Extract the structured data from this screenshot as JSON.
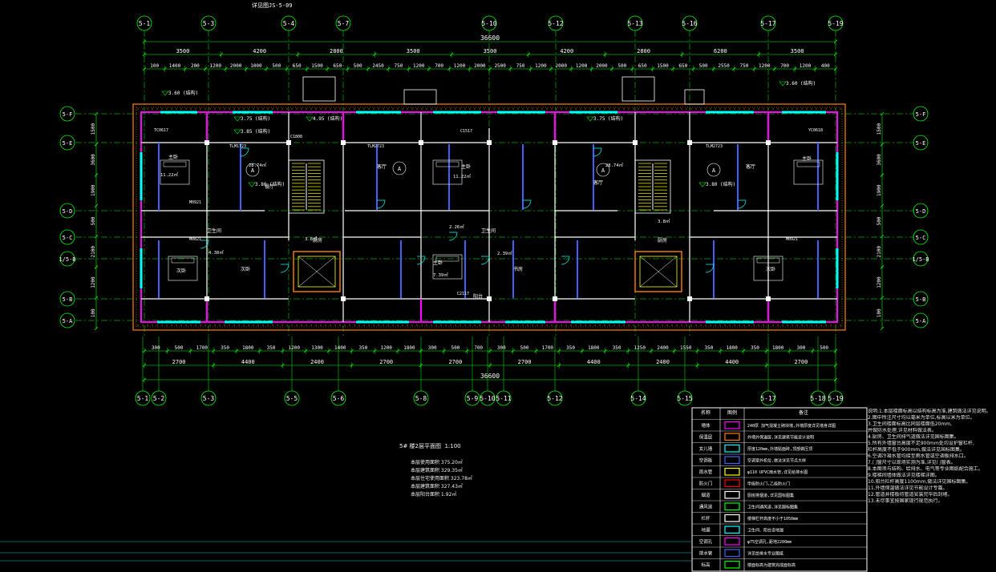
{
  "drawing": {
    "total_dim_top": "36600",
    "total_dim_bottom": "36600",
    "scale_title": "5# 楼2层平面图",
    "scale": "1:100",
    "ref_label": "详见图JS-5-09",
    "area_lines": [
      "本层使用面积 375.20㎡",
      "本层建筑面积 329.35㎡",
      "本层住宅使用面积 323.78㎡",
      "本层建筑面积 327.43㎡",
      "本层阳台面积 1.92㎡"
    ]
  },
  "axes_top": [
    "5-1",
    "5-3",
    "5-4",
    "5-7",
    "5-10",
    "5-12",
    "5-13",
    "5-16",
    "5-17",
    "5-19"
  ],
  "axes_bottom": [
    "5-1",
    "5-2",
    "5-3",
    "5-5",
    "5-6",
    "5-8",
    "5-9",
    "5-10",
    "5-11",
    "5-12",
    "5-14",
    "5-15",
    "5-17",
    "5-18",
    "5-19"
  ],
  "axes_left": [
    "5-F",
    "5-E",
    "5-D",
    "5-C",
    "1/5-B",
    "5-B",
    "5-A"
  ],
  "axes_right": [
    "5-F",
    "5-E",
    "5-D",
    "5-C",
    "1/5-B",
    "5-B",
    "5-A"
  ],
  "dims_top_row1": [
    "3500",
    "4200",
    "2800",
    "3500",
    "3500",
    "4200",
    "2800",
    "6200",
    "3500"
  ],
  "dims_top_row2": [
    "100",
    "1400",
    "200",
    "1200",
    "2000",
    "1000",
    "500",
    "650",
    "1500",
    "650",
    "500",
    "2450",
    "750",
    "1200",
    "700",
    "1200",
    "2000",
    "2500",
    "750",
    "1200",
    "2000",
    "1200",
    "2000",
    "500",
    "650",
    "1500",
    "650",
    "500",
    "2550",
    "750",
    "1200",
    "700",
    "1200",
    "400"
  ],
  "dims_bottom_row1": [
    "300",
    "500",
    "1700",
    "350",
    "1800",
    "350",
    "1200",
    "1300",
    "1400",
    "350",
    "1200",
    "1800",
    "300",
    "500",
    "700",
    "300",
    "500",
    "1700",
    "350",
    "1800",
    "350",
    "1250",
    "2400",
    "1550",
    "350",
    "1800",
    "350",
    "1800",
    "300",
    "500"
  ],
  "dims_bottom_row2": [
    "2700",
    "4400",
    "2400",
    "2700",
    "2700",
    "2700",
    "4400",
    "2400",
    "4400",
    "2700"
  ],
  "dims_left": [
    "1500",
    "3600",
    "1900",
    "500",
    "2100",
    "1200",
    "100"
  ],
  "dims_right": [
    "1500",
    "3600",
    "1900",
    "500",
    "2100",
    "1200",
    "100"
  ],
  "room_labels": [
    "主卧",
    "主卧",
    "次卧",
    "次卧",
    "客厅",
    "客厅",
    "卫生间",
    "卫生间",
    "厨房",
    "厨房",
    "餐厅",
    "阳台",
    "书房",
    "主卧",
    "主卧",
    "客厅",
    "次卧"
  ],
  "room_areas": [
    "11.22㎡",
    "11.22㎡",
    "28.74㎡",
    "28.74㎡",
    "4.38㎡",
    "2.26㎡",
    "7.39㎡",
    "2.39㎡",
    "3.8㎡",
    "3.8㎡"
  ],
  "elevations": [
    "3.75 (结构)",
    "3.60 (结构)",
    "3.80 (结构)",
    "3.85 (结构)",
    "4.95 (结构)",
    "3.75 (结构)",
    "3.60 (结构)",
    "3.80 (结构)"
  ],
  "door_tags": [
    "M0921",
    "M0821",
    "TLM1723",
    "C1808",
    "TLM2723",
    "C1517",
    "TLM2723",
    "M0921",
    "C2117",
    "TC0617",
    "YC0618"
  ],
  "legend": {
    "header": [
      "名称",
      "图例",
      "备注"
    ],
    "rows": [
      {
        "name": "墙体",
        "note": "240厚 加气混凝土砌块墙,外墙厚度详见墙身详图"
      },
      {
        "name": "保温层",
        "note": "外墙外保温层,详见建筑节能设计说明"
      },
      {
        "name": "女儿墙",
        "note": "厚度120mm,外墙贴面砖,顶部做压顶"
      },
      {
        "name": "空调板",
        "note": "空调室外机位,做法详见节点大样"
      },
      {
        "name": "雨水管",
        "note": "φ110 UPVC雨水管,详见给排水图"
      },
      {
        "name": "防火门",
        "note": "甲级防火门,乙级防火门"
      },
      {
        "name": "烟道",
        "note": "厨房排烟道,详见国标图集"
      },
      {
        "name": "通风道",
        "note": "卫生间通风道,详见国标图集"
      },
      {
        "name": "栏杆",
        "note": "楼梯栏杆高度不小于1050mm"
      },
      {
        "name": "地漏",
        "note": "卫生间、阳台设地漏"
      },
      {
        "name": "空调孔",
        "note": "φ75空调孔,距地2200mm"
      },
      {
        "name": "排水管",
        "note": "详见给排水专业图纸"
      },
      {
        "name": "标高",
        "note": "楼面标高为建筑完成面标高"
      }
    ]
  },
  "notes": [
    "说明:1.本层楼面标高以结构标高为准,建筑做法详见说明。",
    "2.图中所注尺寸均以毫米为单位,标高以米为单位。",
    "3.卫生间楼面标高比同层楼面低20mm,",
    "并做防水处理,详见材料做法表。",
    "4.厨房、卫生间排气道做法详见国标图集。",
    "5.所有外墙窗台高度不足900mm处均设护窗栏杆,",
    "栏杆高度不低于900mm,做法详见国标图集。",
    "6.空调冷凝水管均接至雨水管或空调板排水口。",
    "7.门窗尺寸以现场实测为准,详见门窗表。",
    "8.本图须与结构、给排水、电气等专业图纸配合施工。",
    "9.楼梯间墙体做法详见楼梯详图。",
    "10.阳台栏杆高度1100mm,做法详见国标图集。",
    "11.外墙保温做法详见节能设计专篇。",
    "12.管道井楼板待管道安装完毕后封堵。",
    "13.未尽事宜按国家现行规范执行。"
  ],
  "colors": {
    "background": "#000000",
    "axis": "#00ff00",
    "dimension": "#00ff00",
    "wall": "#ff00ff",
    "wall_inner": "#ffffff",
    "insulation": "#ff8000",
    "window": "#00ffff",
    "door": "#4060ff",
    "text": "#ffffff",
    "elev_text": "#ffff00",
    "stair": "#ffff00"
  }
}
